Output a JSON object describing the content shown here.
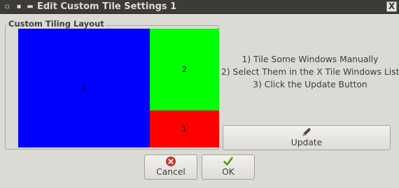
{
  "window": {
    "title": "Edit Custom Tile Settings 1",
    "close_glyph": "X"
  },
  "layout_frame": {
    "label": "Custom Tiling Layout",
    "tiles": [
      {
        "label": "3",
        "color": "#0000ff"
      },
      {
        "label": "2",
        "color": "#00ff00"
      },
      {
        "label": "1",
        "color": "#ff0000"
      }
    ]
  },
  "instructions": [
    "1) Tile Some Windows Manually",
    "2) Select Them in the X Tile Windows List",
    "3) Click the Update Button"
  ],
  "buttons": {
    "update": {
      "label": "Update",
      "icon": "pencil-icon"
    },
    "cancel": {
      "label": "Cancel",
      "icon": "cancel-icon"
    },
    "ok": {
      "label": "OK",
      "icon": "checkmark-icon"
    }
  }
}
